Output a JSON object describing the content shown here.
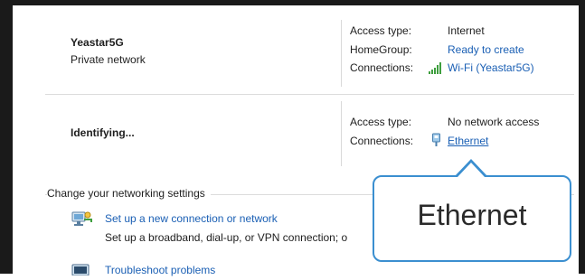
{
  "networks": [
    {
      "name": "Yeastar5G",
      "category": "Private network",
      "access_type_label": "Access type:",
      "access_type_value": "Internet",
      "homegroup_label": "HomeGroup:",
      "homegroup_value": "Ready to create",
      "connections_label": "Connections:",
      "connections_value": "Wi-Fi (Yeastar5G)"
    },
    {
      "name": "Identifying...",
      "access_type_label": "Access type:",
      "access_type_value": "No network access",
      "connections_label": "Connections:",
      "connections_value": "Ethernet"
    }
  ],
  "settings": {
    "title": "Change your networking settings",
    "tasks": [
      {
        "link": "Set up a new connection or network",
        "desc": "Set up a broadband, dial-up, or VPN connection; o"
      },
      {
        "link": "Troubleshoot problems"
      }
    ]
  },
  "callout": {
    "text": "Ethernet",
    "border_color": "#3b8fd0"
  },
  "colors": {
    "link": "#1a5fb4",
    "wifi_signal": "#3e9e3e"
  }
}
